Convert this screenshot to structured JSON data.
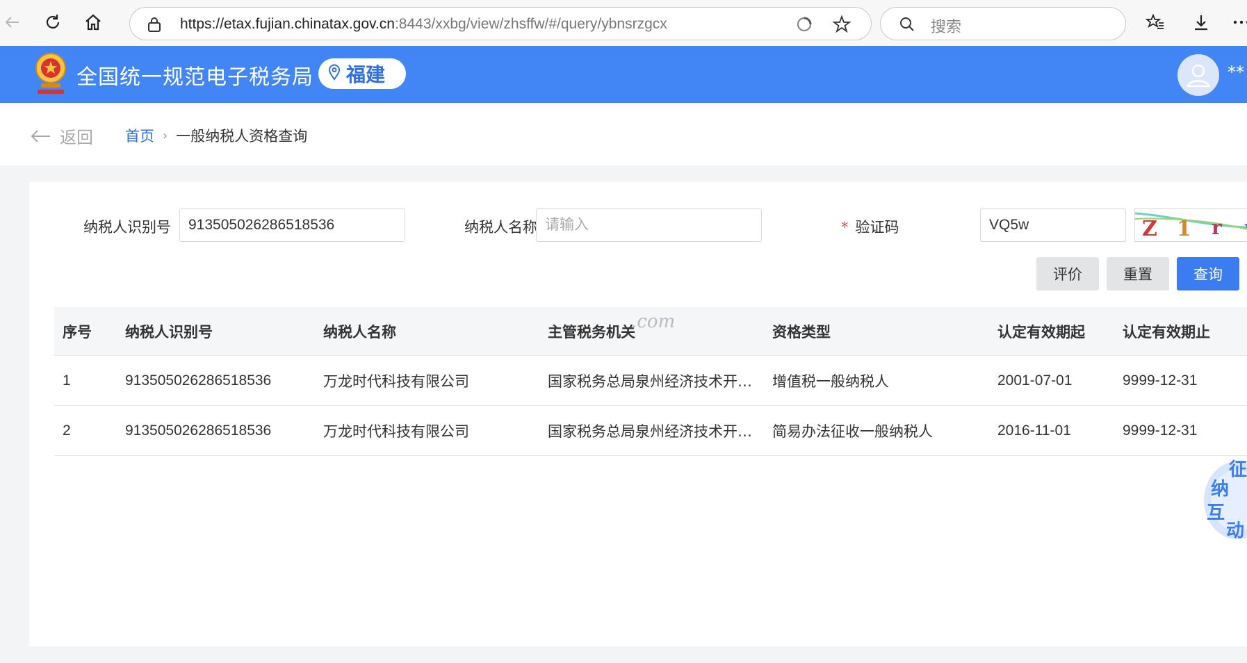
{
  "browser": {
    "url_host": "https://etax.fujian.chinatax.gov.cn",
    "url_path": ":8443/xxbg/view/zhsffw/#/query/ybnsrzgcx",
    "search_placeholder": "搜索",
    "icons": [
      "back-icon",
      "reload-icon",
      "home-icon",
      "lock-icon",
      "refresh-app-icon",
      "star-icon",
      "search-icon",
      "favorites-icon",
      "download-icon",
      "more-icon"
    ]
  },
  "header": {
    "site_title": "全国统一规范电子税务局",
    "region": "福建",
    "user_name_masked": "**",
    "brand_color": "#4285f4"
  },
  "breadcrumb": {
    "back_label": "返回",
    "home": "首页",
    "current": "一般纳税人资格查询"
  },
  "form": {
    "taxpayer_id_label": "纳税人识别号",
    "taxpayer_id_value": "913505026286518536",
    "taxpayer_name_label": "纳税人名称",
    "taxpayer_name_placeholder": "请输入",
    "captcha_label": "验证码",
    "captcha_required_mark": "*",
    "captcha_value": "VQ5w",
    "buttons": {
      "evaluate": "评价",
      "reset": "重置",
      "query": "查询"
    }
  },
  "table": {
    "columns": [
      "序号",
      "纳税人识别号",
      "纳税人名称",
      "主管税务机关",
      "资格类型",
      "认定有效期起",
      "认定有效期止"
    ],
    "rows": [
      [
        "1",
        "913505026286518536",
        "万龙时代科技有限公司",
        "国家税务总局泉州经济技术开…",
        "增值税一般纳税人",
        "2001-07-01",
        "9999-12-31"
      ],
      [
        "2",
        "913505026286518536",
        "万龙时代科技有限公司",
        "国家税务总局泉州经济技术开…",
        "简易办法征收一般纳税人",
        "2016-11-01",
        "9999-12-31"
      ]
    ]
  },
  "watermark": ".com",
  "float_badge": "纳互动征"
}
